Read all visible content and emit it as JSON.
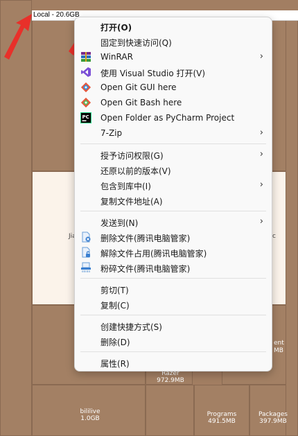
{
  "header": {
    "title": "Local - 20.6GB"
  },
  "treemap": {
    "cells": [
      {
        "name": "Razer",
        "size": "972.9MB"
      },
      {
        "name": "bililive",
        "size": "1.0GB"
      },
      {
        "name": "Programs",
        "size": "491.5MB"
      },
      {
        "name": "Packages",
        "size": "397.9MB"
      }
    ],
    "partials": {
      "left": "Jia",
      "right1": "ent",
      "right2": "MB",
      "far_right": "c"
    }
  },
  "context_menu": {
    "items": [
      {
        "label": "打开(O)",
        "icon": "none",
        "submenu": false
      },
      {
        "label": "固定到快速访问(Q)",
        "icon": "none",
        "submenu": false
      },
      {
        "label": "WinRAR",
        "icon": "winrar-icon",
        "submenu": true
      },
      {
        "label": "使用 Visual Studio 打开(V)",
        "icon": "visual-studio-icon",
        "submenu": false
      },
      {
        "label": "Open Git GUI here",
        "icon": "git-gui-icon",
        "submenu": false
      },
      {
        "label": "Open Git Bash here",
        "icon": "git-bash-icon",
        "submenu": false
      },
      {
        "label": "Open Folder as PyCharm Project",
        "icon": "pycharm-icon",
        "submenu": false
      },
      {
        "label": "7-Zip",
        "icon": "none",
        "submenu": true
      },
      {
        "label": "授予访问权限(G)",
        "icon": "none",
        "submenu": true
      },
      {
        "label": "还原以前的版本(V)",
        "icon": "none",
        "submenu": false
      },
      {
        "label": "包含到库中(I)",
        "icon": "none",
        "submenu": true
      },
      {
        "label": "复制文件地址(A)",
        "icon": "none",
        "submenu": false
      },
      {
        "label": "发送到(N)",
        "icon": "none",
        "submenu": true
      },
      {
        "label": "删除文件(腾讯电脑管家)",
        "icon": "tencent-delete-icon",
        "submenu": false
      },
      {
        "label": "解除文件占用(腾讯电脑管家)",
        "icon": "tencent-unlock-icon",
        "submenu": false
      },
      {
        "label": "粉碎文件(腾讯电脑管家)",
        "icon": "tencent-shred-icon",
        "submenu": false
      },
      {
        "label": "剪切(T)",
        "icon": "none",
        "submenu": false
      },
      {
        "label": "复制(C)",
        "icon": "none",
        "submenu": false
      },
      {
        "label": "创建快捷方式(S)",
        "icon": "none",
        "submenu": false
      },
      {
        "label": "删除(D)",
        "icon": "none",
        "submenu": false
      },
      {
        "label": "属性(R)",
        "icon": "none",
        "submenu": false
      }
    ],
    "submenu_glyph": "›"
  },
  "colors": {
    "annotation_arrow": "#e8302a",
    "treemap_fill": "#a38064",
    "treemap_light": "#fbf3ea"
  }
}
